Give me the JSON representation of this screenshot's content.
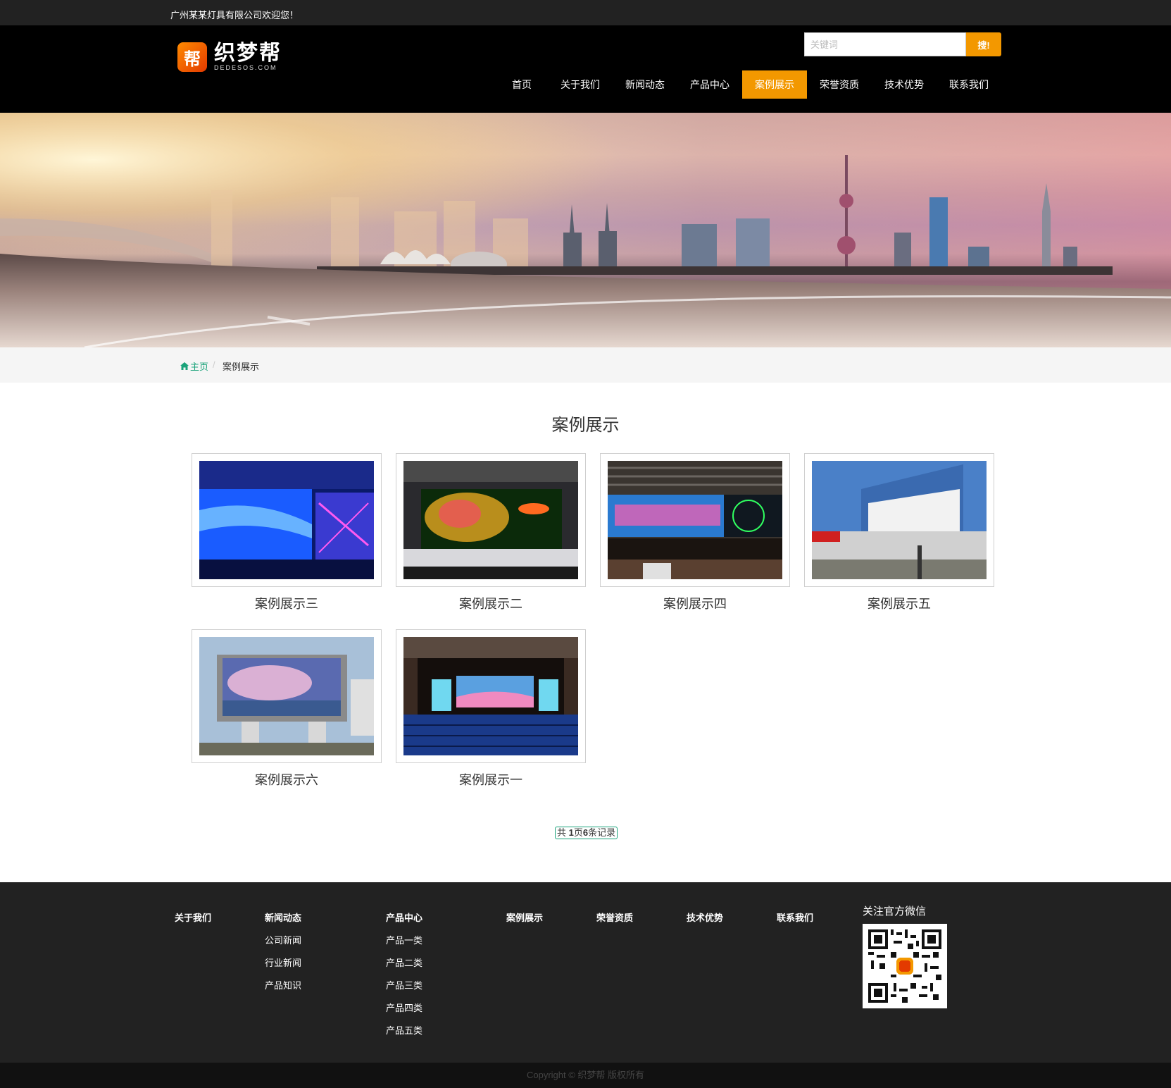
{
  "topbar": {
    "welcome": "广州某某灯具有限公司欢迎您！"
  },
  "logo": {
    "badge": "帮",
    "name": "织梦帮",
    "domain": "DEDESOS.COM"
  },
  "search": {
    "placeholder": "关键词",
    "button": "搜!"
  },
  "nav": {
    "items": [
      "首页",
      "关于我们",
      "新闻动态",
      "产品中心",
      "案例展示",
      "荣誉资质",
      "技术优势",
      "联系我们"
    ],
    "active": "案例展示"
  },
  "breadcrumb": {
    "home": "主页",
    "separator": "/",
    "current": "案例展示"
  },
  "main": {
    "title": "案例展示",
    "cases": [
      {
        "caption": "案例展示三",
        "image": "led-screen-hall-blue"
      },
      {
        "caption": "案例展示二",
        "image": "led-screen-lobby-tree"
      },
      {
        "caption": "案例展示四",
        "image": "led-screen-station-board"
      },
      {
        "caption": "案例展示五",
        "image": "outdoor-led-yacht"
      },
      {
        "caption": "案例展示六",
        "image": "outdoor-led-cherry-blossom"
      },
      {
        "caption": "案例展示一",
        "image": "auditorium-led-stage"
      }
    ],
    "pager": {
      "prefix": "共 ",
      "pages": "1",
      "mid": "页",
      "records": "6",
      "suffix": "条记录"
    }
  },
  "footer": {
    "columns": [
      {
        "head": "关于我们",
        "links": []
      },
      {
        "head": "新闻动态",
        "links": [
          "公司新闻",
          "行业新闻",
          "产品知识"
        ]
      },
      {
        "head": "产品中心",
        "links": [
          "产品一类",
          "产品二类",
          "产品三类",
          "产品四类",
          "产品五类"
        ]
      },
      {
        "head": "案例展示",
        "links": []
      },
      {
        "head": "荣誉资质",
        "links": []
      },
      {
        "head": "技术优势",
        "links": []
      },
      {
        "head": "联系我们",
        "links": []
      }
    ],
    "wechat": {
      "title": "关注官方微信"
    },
    "copyright": "Copyright © 织梦帮 版权所有"
  },
  "colors": {
    "accent": "#f39800",
    "header": "#000000",
    "topbar": "#222222",
    "footer": "#222222",
    "link_green": "#1aa37a"
  }
}
